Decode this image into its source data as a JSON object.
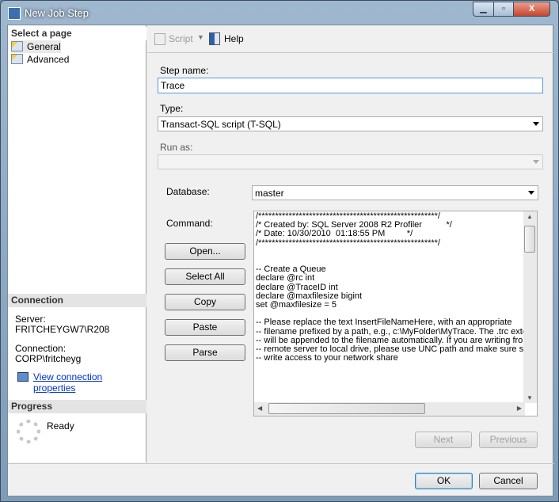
{
  "window": {
    "title": "New Job Step"
  },
  "left": {
    "select_header": "Select a page",
    "pages": [
      {
        "label": "General"
      },
      {
        "label": "Advanced"
      }
    ],
    "connection_header": "Connection",
    "server_label": "Server:",
    "server_value": "FRITCHEYGW7\\R208",
    "connection_label": "Connection:",
    "connection_value": "CORP\\fritcheyg",
    "view_link": "View connection properties",
    "progress_header": "Progress",
    "progress_status": "Ready"
  },
  "toolbar": {
    "script": "Script",
    "help": "Help"
  },
  "form": {
    "step_name_label": "Step name:",
    "step_name_value": "Trace",
    "type_label": "Type:",
    "type_value": "Transact-SQL script (T-SQL)",
    "run_as_label": "Run as:",
    "run_as_value": "",
    "database_label": "Database:",
    "database_value": "master",
    "command_label": "Command:",
    "command_text": "/*****************************************************/\n/* Created by: SQL Server 2008 R2 Profiler          */\n/* Date: 10/30/2010  01:18:55 PM         */\n/*****************************************************/\n\n\n-- Create a Queue\ndeclare @rc int\ndeclare @TraceID int\ndeclare @maxfilesize bigint\nset @maxfilesize = 5\n\n-- Please replace the text InsertFileNameHere, with an appropriate\n-- filename prefixed by a path, e.g., c:\\MyFolder\\MyTrace. The .trc extension\n-- will be appended to the filename automatically. If you are writing from\n-- remote server to local drive, please use UNC path and make sure server has\n-- write access to your network share",
    "buttons": {
      "open": "Open...",
      "select_all": "Select All",
      "copy": "Copy",
      "paste": "Paste",
      "parse": "Parse"
    },
    "next": "Next",
    "previous": "Previous"
  },
  "footer": {
    "ok": "OK",
    "cancel": "Cancel"
  }
}
